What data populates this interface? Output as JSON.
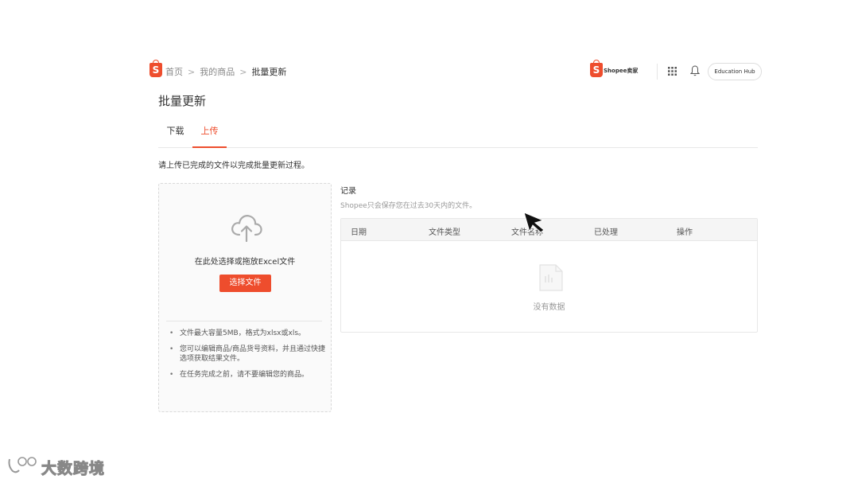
{
  "breadcrumb": {
    "logo_letter": "S",
    "items": [
      "首页",
      "我的商品"
    ],
    "current": "批量更新",
    "separator": ">"
  },
  "header": {
    "brand_logo_letter": "S",
    "brand_text": "Shopee卖家",
    "apps_icon": "grid-icon",
    "bell_icon": "bell-icon",
    "education_hub_label": "Education Hub"
  },
  "page": {
    "title": "批量更新"
  },
  "tabs": [
    {
      "label": "下载",
      "active": false
    },
    {
      "label": "上传",
      "active": true
    }
  ],
  "intro_text": "请上传已完成的文件以完成批量更新过程。",
  "upload": {
    "icon": "cloud-upload-icon",
    "drop_text": "在此处选择或拖放Excel文件",
    "select_button": "选择文件",
    "notes": [
      "文件最大容量5MB，格式为xlsx或xls。",
      "您可以编辑商品/商品货号资料，并且通过快捷选项获取结果文件。",
      "在任务完成之前，请不要编辑您的商品。"
    ]
  },
  "records": {
    "title": "记录",
    "subtitle": "Shopee只会保存您在过去30天内的文件。",
    "columns": [
      "日期",
      "文件类型",
      "文件名称",
      "已处理",
      "操作"
    ],
    "rows": [],
    "empty_text": "没有数据",
    "empty_icon": "empty-document-icon"
  },
  "watermark": {
    "text": "大数跨境"
  },
  "colors": {
    "accent": "#ee4d2d",
    "border": "#e8e8e8",
    "muted_text": "#999999"
  }
}
